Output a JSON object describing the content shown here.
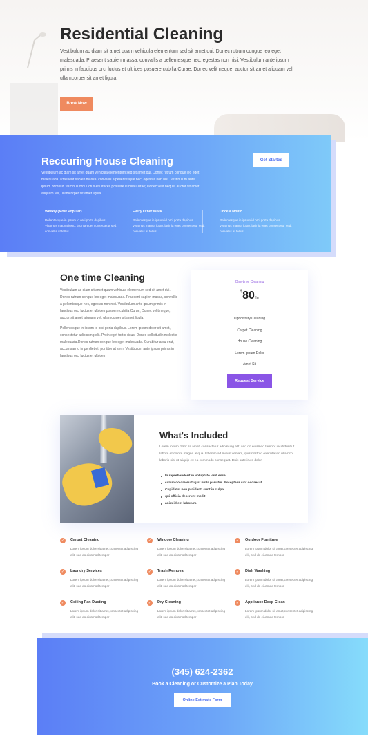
{
  "hero": {
    "title": "Residential Cleaning",
    "body": "Vestibulum ac diam sit amet quam vehicula elementum sed sit amet dui. Donec rutrum congue leo eget malesuada. Praesent sapien massa, convallis a pellentesque nec, egestas non nisi. Vestibulum ante ipsum primis in faucibus orci luctus et ultrices posuere cubilia Curae; Donec velit neque, auctor sit amet aliquam vel, ullamcorper sit amet ligula.",
    "button": "Book Now"
  },
  "recurring": {
    "title": "Reccuring House Cleaning",
    "body": "Vestibulum ac diam sit amet quam vehicula elementum sed sit amet dui. Donec rutrum congue leo eget malesuada. Praesent sapien massa, convallis a pellentesque nec, egestas non nisi. Vestibulum ante ipsum primis in faucibus orci luctus et ultrices posuere cubilia Curae; Donec velit neque, auctor sit amet aliquam vel, ullamcorper sit amet ligula.",
    "button": "Get Started",
    "options": [
      {
        "title": "Weekly (Most Popular)",
        "text": "Pellentesque in ipsum id orci porta dapibus. Vivamus magna justo, lacinia eget consectetur sed, convallis at tellus."
      },
      {
        "title": "Every Other Week",
        "text": "Pellentesque in ipsum id orci porta dapibus. Vivamus magna justo, lacinia eget consectetur sed, convallis at tellus."
      },
      {
        "title": "Once a Month",
        "text": "Pellentesque in ipsum id orci porta dapibus. Vivamus magna justo, lacinia eget consectetur sed, convallis at tellus."
      }
    ]
  },
  "one_time": {
    "title": "One time Cleaning",
    "para1": "Vestibulum ac diam sit amet quam vehicula elementum sed sit amet dui. Donec rutrum congue leo eget malesuada. Praesent sapien massa, convallis a pellentesque nec, egestas non nisi. Vestibulum ante ipsum primis in faucibus orci luctus et ultrices posuere cubilia Curae; Donec velit neque, auctor sit amet aliquam vel, ullamcorper sit amet ligula.",
    "para2": "Pellentesque in ipsum id orci porta dapibus. Lorem ipsum dolor sit amet, consectetur adipiscing elit. Proin eget tortor risus. Donec sollicitudin molestie malesuada.Donec rutrum congue leo eget malesuada. Curabitur arcu erat, accumsan id imperdiet et, porttitor at sem. Vestibulum ante ipsum primis in faucibus orci luctus et ultrices",
    "card": {
      "kicker": "One-time Cleaning",
      "currency": "$",
      "price": "80",
      "per": "/hr",
      "features": [
        "Upholstery Cleaning",
        "Carpet Cleaning",
        "House Cleaning",
        "Lorem Ipsum Dolor",
        "Amet Sit"
      ],
      "button": "Request Service"
    }
  },
  "included": {
    "title": "What's Included",
    "body": "Lorem ipsum dolor sit amet, consectetur adipiscing elit, sed do eiusmod tempor incididunt ut labore et dolore magna aliqua. Ut enim ad minim veniam, quis nostrud exercitation ullamco laboris nisi ut aliquip ex ea commodo consequat. Duis aute irure dolor",
    "bullets": [
      "In reprehenderit in voluptate velit esse",
      "cillum dolore eu fugiat nulla pariatur. Excepteur sint occaecat",
      "Cupidatat non proident, sunt in culpa",
      "qui officia deserunt mollit",
      "anim id est laborum."
    ]
  },
  "services": [
    {
      "title": "Carpet Cleaning",
      "text": "Lorem ipsum dolor sit amet,consectet adipiscing elit, sed do eiusmod tempor"
    },
    {
      "title": "Window Cleaning",
      "text": "Lorem ipsum dolor sit amet,consectet adipiscing elit, sed do eiusmod tempor"
    },
    {
      "title": "Outdoor Furniture",
      "text": "Lorem ipsum dolor sit amet,consectet adipiscing elit, sed do eiusmod tempor"
    },
    {
      "title": "Laundry Services",
      "text": "Lorem ipsum dolor sit amet,consectet adipiscing elit, sed do eiusmod tempor"
    },
    {
      "title": "Trash Removal",
      "text": "Lorem ipsum dolor sit amet,consectet adipiscing elit, sed do eiusmod tempor"
    },
    {
      "title": "Dish Washing",
      "text": "Lorem ipsum dolor sit amet,consectet adipiscing elit, sed do eiusmod tempor"
    },
    {
      "title": "Ceiling Fan Dusting",
      "text": "Lorem ipsum dolor sit amet,consectet adipiscing elit, sed do eiusmod tempor"
    },
    {
      "title": "Dry Cleaning",
      "text": "Lorem ipsum dolor sit amet,consectet adipiscing elit, sed do eiusmod tempor"
    },
    {
      "title": "Appliance Deep Clean",
      "text": "Lorem ipsum dolor sit amet,consectet adipiscing elit, sed do eiusmod tempor"
    }
  ],
  "check_glyph": "✓",
  "cta": {
    "phone": "(345) 624-2362",
    "subtitle": "Book a Cleaning or Customize a Plan Today",
    "button": "Online Estimate Form"
  },
  "colors": {
    "accent_orange": "#ef8a5f",
    "accent_purple": "#8a55e6",
    "gradient_start": "#5b7ef6",
    "gradient_end": "#86dcfb"
  }
}
